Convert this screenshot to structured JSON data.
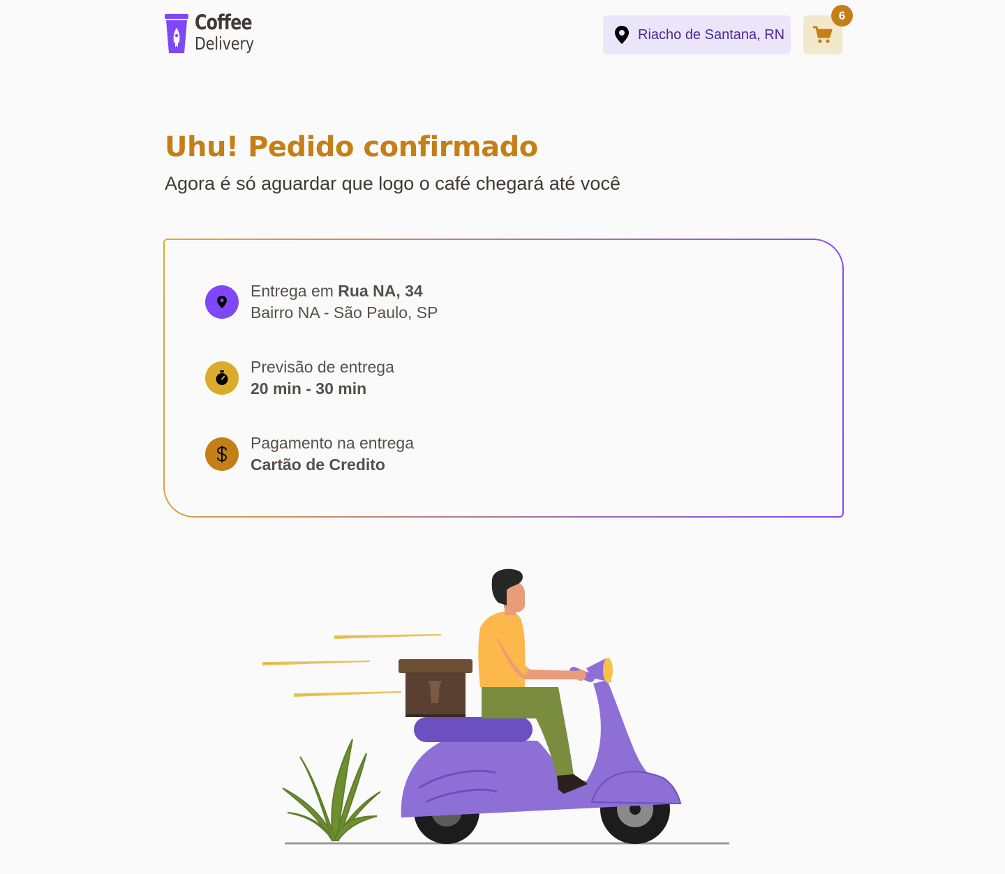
{
  "header": {
    "logo": {
      "line1": "Coffee",
      "line2": "Delivery"
    },
    "location": {
      "label": "Riacho de Santana, RN",
      "icon": "map-pin-icon"
    },
    "cart": {
      "icon": "shopping-cart-icon",
      "count": "6"
    }
  },
  "confirmation": {
    "title": "Uhu! Pedido confirmado",
    "subtitle": "Agora é só aguardar que logo o café chegará até você"
  },
  "order_info": {
    "delivery": {
      "prefix": "Entrega em ",
      "street": "Rua NA, 34",
      "district": "Bairro NA - São Paulo, SP",
      "icon": "map-pin-icon",
      "color": "#8047f8"
    },
    "estimate": {
      "label": "Previsão de entrega",
      "value": "20 min - 30 min",
      "icon": "timer-icon",
      "color": "#dbac2c"
    },
    "payment": {
      "label": "Pagamento na entrega",
      "value": "Cartão de Credito",
      "icon": "dollar-icon",
      "color": "#c47f17"
    }
  },
  "colors": {
    "brand_purple": "#8047f8",
    "brand_yellow": "#dbac2c",
    "brand_yellow_dark": "#c47f17",
    "purple_light": "#ebe5f9",
    "yellow_light": "#f1e9c9"
  }
}
